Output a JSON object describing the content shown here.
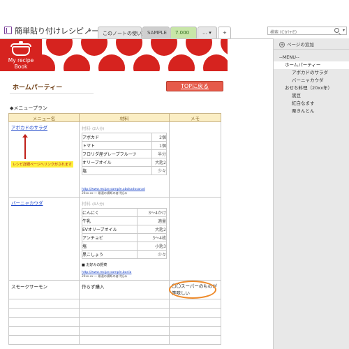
{
  "app": {
    "title": "簡単貼り付けレシピノート",
    "title_dropdown": "▾"
  },
  "tabs": [
    {
      "label": "このノートの使い方"
    },
    {
      "label": "SAMPLE"
    },
    {
      "label": "7.000"
    },
    {
      "label": "… ▾"
    },
    {
      "label": "+"
    }
  ],
  "search": {
    "placeholder": "検索 (Ctrl+E)",
    "caret": "▾"
  },
  "banner": {
    "book_title": "My recipe Book"
  },
  "page": {
    "title": "ホームパーティー",
    "top_button": "TOPに戻る",
    "menu_heading": "◆メニュープラン",
    "columns": [
      "メニュー名",
      "材料",
      "メモ"
    ]
  },
  "recipes": [
    {
      "name": "アボカドのサラダ",
      "note": "レシピ詳細ページへリンクがされます",
      "ing_title": "材料",
      "ing_serving": "(2人分)",
      "ingredients": [
        {
          "item": "アボカド",
          "amount": "2個"
        },
        {
          "item": "トマト",
          "amount": "1個"
        },
        {
          "item": "フロリダ産グレープフルーツ",
          "amount": "半分"
        },
        {
          "item": "オリーブオイル",
          "amount": "大匙2"
        },
        {
          "item": "塩",
          "amount": "少々"
        }
      ],
      "url": "http://www.recipe.sample.abokadosarad",
      "url_note": "20xx.xx ～ 最適の横断の者代記み"
    },
    {
      "name": "バーニャカウダ",
      "ing_title": "材料",
      "ing_serving": "(4人分)",
      "ingredients": [
        {
          "item": "にんにく",
          "amount": "3～4かけ"
        },
        {
          "item": "牛乳",
          "amount": "適量"
        },
        {
          "item": "EVオリーブオイル",
          "amount": "大匙2"
        },
        {
          "item": "アンチョビ",
          "amount": "3～4枚"
        },
        {
          "item": "塩",
          "amount": "小匙3"
        },
        {
          "item": "黒こしょう",
          "amount": "少々"
        }
      ],
      "extra": "■ お好みの野菜",
      "url": "http://www.recipe.sample.bania",
      "url_note": "20xx.xx ～ 最適の横断の者代記み"
    },
    {
      "name": "スモークサーモン",
      "ingredient_text": "作らず購入",
      "memo": "〇〇スーパーのものが美味しい"
    }
  ],
  "sidebar": {
    "add_page": "ページの追加",
    "pages": [
      {
        "label": "--MENU--",
        "level": 0,
        "selected": false
      },
      {
        "label": "ホームパーティー",
        "level": 1,
        "selected": true
      },
      {
        "label": "アボカドのサラダ",
        "level": 2,
        "selected": false
      },
      {
        "label": "バーニャカウダ",
        "level": 2,
        "selected": false
      },
      {
        "label": "おせち料理（20xx年）",
        "level": 1,
        "selected": false
      },
      {
        "label": "黒豆",
        "level": 2,
        "selected": false
      },
      {
        "label": "紅白なます",
        "level": 2,
        "selected": false
      },
      {
        "label": "栗きんとん",
        "level": 2,
        "selected": false
      }
    ]
  },
  "colors": {
    "banner_red": "#d6231f",
    "top_button": "#e65a4a",
    "table_header": "#fbeec4",
    "memo_circle": "#ee8a2a",
    "link": "#1a44c8"
  }
}
